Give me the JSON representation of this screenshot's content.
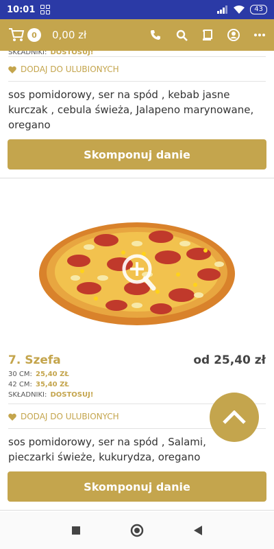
{
  "status": {
    "time": "10:01",
    "battery": "43"
  },
  "header": {
    "cart_count": "0",
    "cart_total": "0,00 zł"
  },
  "prev_item": {
    "ingredients_label": "SKŁADNIKI:",
    "ingredients_link": "DOSTOSUJ!",
    "favorite_label": "DODAJ DO ULUBIONYCH",
    "description": "sos pomidorowy, ser na spód , kebab jasne kurczak , cebula świeża, Jalapeno marynowane, oregano",
    "compose_label": "Skomponuj danie"
  },
  "item": {
    "name": "7. Szefa",
    "price": "od 25,40 zł",
    "sizes": [
      {
        "label": "30 CM:",
        "price": "25,40 ZŁ"
      },
      {
        "label": "42 CM:",
        "price": "35,40 ZŁ"
      }
    ],
    "ingredients_label": "SKŁADNIKI:",
    "ingredients_link": "DOSTOSUJ!",
    "favorite_label": "DODAJ DO ULUBIONYCH",
    "description": "sos pomidorowy, ser na spód , Salami, pieczarki świeże, kukurydza, oregano",
    "compose_label": "Skomponuj danie"
  },
  "colors": {
    "accent": "#c4a54d",
    "status_bar": "#2b3aa6"
  },
  "icons": [
    "cart-icon",
    "phone-icon",
    "search-icon",
    "book-icon",
    "account-icon",
    "more-icon",
    "heart-icon",
    "zoom-icon",
    "arrow-up-icon"
  ]
}
